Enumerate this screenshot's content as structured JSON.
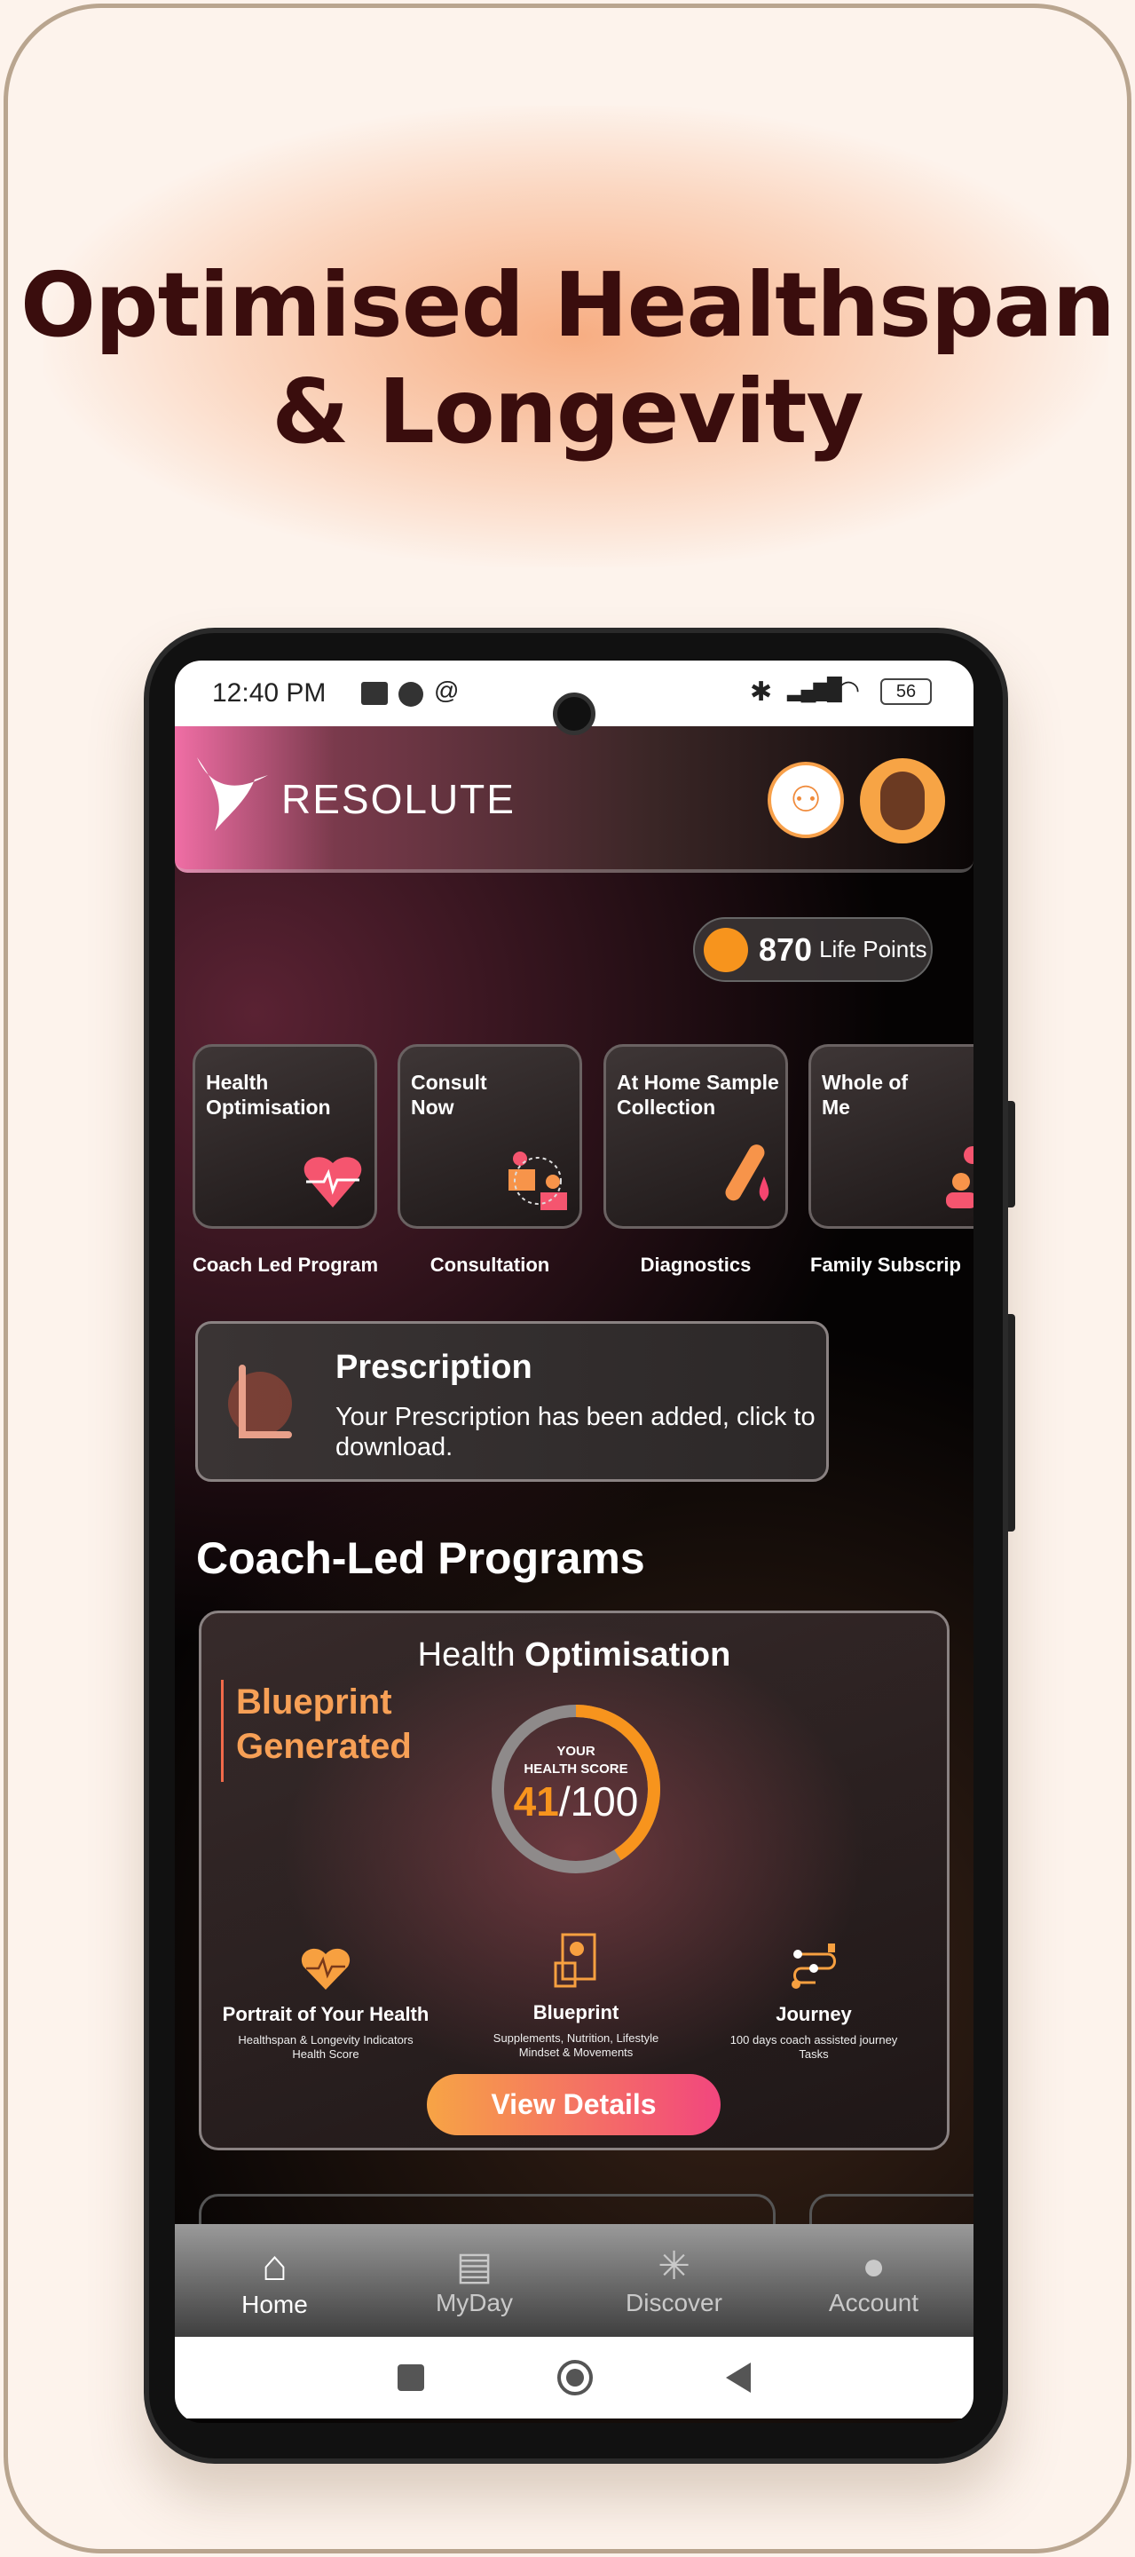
{
  "headline": {
    "line1": "Optimised Healthspan",
    "line2": "& Longevity"
  },
  "status_bar": {
    "time": "12:40 PM",
    "battery": "56"
  },
  "header": {
    "brand": "RESOLUTE",
    "add_member_icon": "user-plus-icon",
    "avatar_icon": "memoji-avatar"
  },
  "life_points": {
    "value": "870",
    "label": "Life Points"
  },
  "services": [
    {
      "title": "Health Optimisation",
      "label": "Coach Led Program",
      "icon": "heart-pulse-icon"
    },
    {
      "title": "Consult Now",
      "label": "Consultation",
      "icon": "consultation-icon"
    },
    {
      "title": "At Home Sample Collection",
      "label": "Diagnostics",
      "icon": "test-tube-icon"
    },
    {
      "title": "Whole of Me",
      "label": "Family Subscrip",
      "icon": "family-icon"
    }
  ],
  "prescription": {
    "title": "Prescription",
    "text": "Your Prescription has been added, click to download."
  },
  "section_title": "Coach-Led Programs",
  "program": {
    "title_light": "Health ",
    "title_bold": "Optimisation",
    "status_line1": "Blueprint",
    "status_line2": "Generated",
    "score_label1": "YOUR",
    "score_label2": "HEALTH SCORE",
    "score": "41",
    "score_max": "/100",
    "score_fraction": 0.41,
    "features": [
      {
        "title": "Portrait of Your Health",
        "sub1": "Healthspan & Longevity Indicators",
        "sub2": "Health Score"
      },
      {
        "title": "Blueprint",
        "sub1": "Supplements, Nutrition, Lifestyle",
        "sub2": "Mindset & Movements"
      },
      {
        "title": "Journey",
        "sub1": "100 days coach assisted journey",
        "sub2": "Tasks"
      }
    ],
    "button": "View Details"
  },
  "bottom_nav": [
    {
      "label": "Home",
      "active": true
    },
    {
      "label": "MyDay"
    },
    {
      "label": "Discover"
    },
    {
      "label": "Account"
    }
  ],
  "colors": {
    "accent_orange": "#f7941d",
    "accent_pink": "#f2467e",
    "title": "#3a0d0d"
  }
}
